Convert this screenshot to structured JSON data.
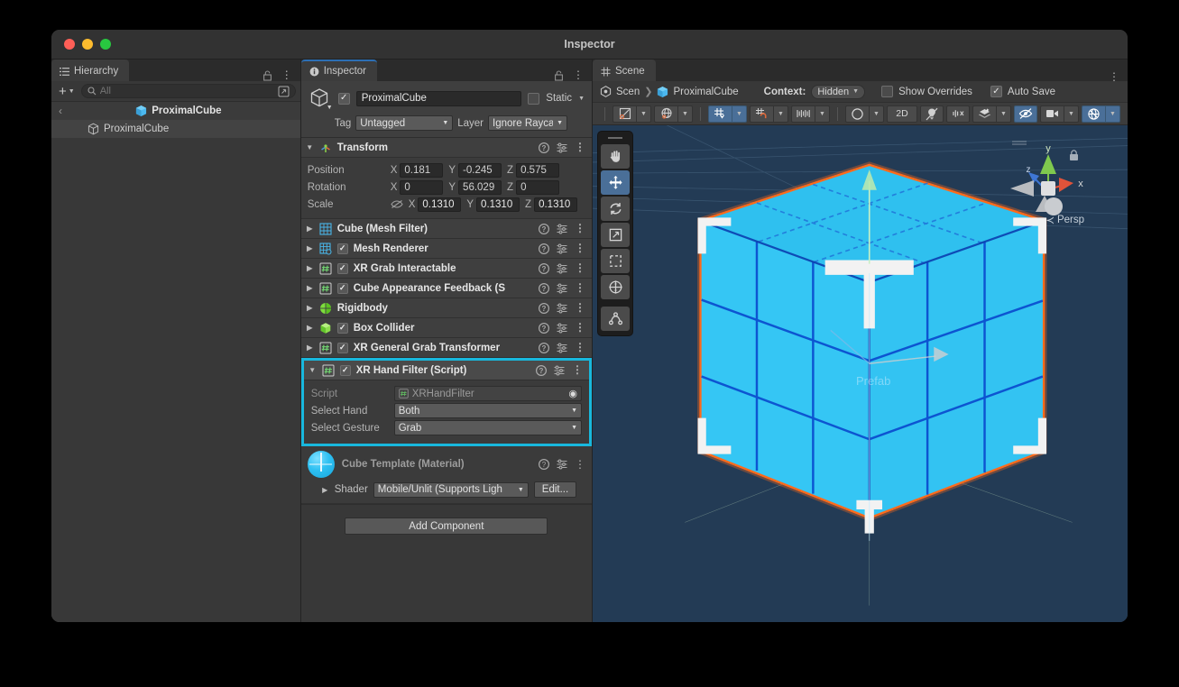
{
  "window": {
    "title": "Inspector"
  },
  "hierarchy": {
    "tab_label": "Hierarchy",
    "add_label": "+",
    "search_placeholder": "All",
    "search_value": "",
    "prefab_root": "ProximalCube",
    "rows": [
      {
        "label": "ProximalCube",
        "type": "prefab-header"
      },
      {
        "label": "ProximalCube",
        "type": "child"
      }
    ]
  },
  "inspector": {
    "tab_label": "Inspector",
    "object": {
      "name": "ProximalCube",
      "enabled": true,
      "static_label": "Static",
      "static_checked": false,
      "tag_label": "Tag",
      "tag_value": "Untagged",
      "layer_label": "Layer",
      "layer_value": "Ignore Raycas"
    },
    "transform": {
      "title": "Transform",
      "rows": [
        {
          "name": "Position",
          "x": "0.181",
          "y": "-0.245",
          "z": "0.575"
        },
        {
          "name": "Rotation",
          "x": "0",
          "y": "56.029",
          "z": "0"
        },
        {
          "name": "Scale",
          "x": "0.1310",
          "y": "0.1310",
          "z": "0.1310"
        }
      ],
      "axis_labels": [
        "X",
        "Y",
        "Z"
      ]
    },
    "components": [
      {
        "title": "Cube (Mesh Filter)",
        "has_checkbox": false,
        "checked": false,
        "icon": "mesh-filter-icon"
      },
      {
        "title": "Mesh Renderer",
        "has_checkbox": true,
        "checked": true,
        "icon": "mesh-renderer-icon"
      },
      {
        "title": "XR Grab Interactable",
        "has_checkbox": true,
        "checked": true,
        "icon": "script-icon"
      },
      {
        "title": "Cube Appearance Feedback (Scrip",
        "has_checkbox": true,
        "checked": true,
        "icon": "script-icon"
      },
      {
        "title": "Rigidbody",
        "has_checkbox": false,
        "checked": false,
        "icon": "rigidbody-icon"
      },
      {
        "title": "Box Collider",
        "has_checkbox": true,
        "checked": true,
        "icon": "box-collider-icon"
      },
      {
        "title": "XR General Grab Transformer",
        "has_checkbox": true,
        "checked": true,
        "icon": "script-icon"
      }
    ],
    "xr_hand_filter": {
      "title": "XR Hand Filter (Script)",
      "checked": true,
      "highlight_color": "#18b8dd",
      "fields": [
        {
          "label": "Script",
          "value": "XRHandFilter",
          "type": "object-ref"
        },
        {
          "label": "Select Hand",
          "value": "Both",
          "type": "enum"
        },
        {
          "label": "Select Gesture",
          "value": "Grab",
          "type": "enum"
        }
      ]
    },
    "material": {
      "title": "Cube Template (Material)",
      "shader_label": "Shader",
      "shader_value": "Mobile/Unlit (Supports Ligh",
      "edit_label": "Edit..."
    },
    "add_component_label": "Add Component"
  },
  "scene": {
    "tab_label": "Scene",
    "breadcrumb": [
      "Scen",
      "ProximalCube"
    ],
    "context_label": "Context:",
    "context_value": "Hidden",
    "show_overrides_label": "Show Overrides",
    "show_overrides_checked": false,
    "auto_save_label": "Auto Save",
    "auto_save_checked": true,
    "toolbar": [
      {
        "name": "draw-mode-dropdown",
        "label": "",
        "icon": "shading-mode-icon",
        "active": false,
        "split": true
      },
      {
        "name": "2d-gizmo-dropdown",
        "label": "",
        "icon": "globe-icon",
        "active": false,
        "split": true
      },
      {
        "name": "grid-snap-toggle",
        "label": "",
        "icon": "grid-snap-icon",
        "active": true,
        "split": true
      },
      {
        "name": "surface-snap-toggle",
        "label": "",
        "icon": "magnet-snap-icon",
        "active": false,
        "split": true
      },
      {
        "name": "grid-visibility-dropdown",
        "label": "",
        "icon": "grid-ruler-icon",
        "active": false,
        "split": true
      },
      {
        "name": "scene-lighting-dropdown",
        "label": "",
        "icon": "shading-ball-icon",
        "active": false,
        "split": true
      },
      {
        "name": "toggle-2d",
        "label": "2D",
        "icon": "",
        "active": false,
        "split": false
      },
      {
        "name": "toggle-lighting",
        "label": "",
        "icon": "light-bulb-icon",
        "active": false,
        "split": false
      },
      {
        "name": "toggle-audio",
        "label": "",
        "icon": "audio-mute-icon",
        "active": false,
        "split": false
      },
      {
        "name": "fx-dropdown",
        "label": "",
        "icon": "fx-layers-icon",
        "active": false,
        "split": true
      },
      {
        "name": "toggle-hidden-objects",
        "label": "",
        "icon": "eye-off-icon",
        "active": true,
        "split": false
      },
      {
        "name": "camera-settings-dropdown",
        "label": "",
        "icon": "camera-icon",
        "active": false,
        "split": true
      },
      {
        "name": "gizmos-dropdown",
        "label": "",
        "icon": "gizmos-globe-icon",
        "active": true,
        "split": true
      }
    ],
    "tools": [
      {
        "name": "hand-tool",
        "icon": "hand-icon",
        "selected": false
      },
      {
        "name": "move-tool",
        "icon": "move-arrows-icon",
        "selected": true
      },
      {
        "name": "rotate-tool",
        "icon": "rotate-icon",
        "selected": false
      },
      {
        "name": "scale-tool",
        "icon": "scale-icon",
        "selected": false
      },
      {
        "name": "rect-tool",
        "icon": "rect-transform-icon",
        "selected": false
      },
      {
        "name": "transform-tool",
        "icon": "transform-combined-icon",
        "selected": false
      },
      {
        "name": "custom-tool",
        "icon": "custom-editor-tool-icon",
        "selected": false
      }
    ],
    "gizmo": {
      "x_label": "x",
      "y_label": "y",
      "z_label": "z",
      "projection_label": "Persp"
    },
    "viewport": {
      "prefab_watermark": "Prefab",
      "background_color": "#233b55",
      "object_color": "#35c6f4",
      "selection_outline_color": "#ff6a1a"
    }
  }
}
